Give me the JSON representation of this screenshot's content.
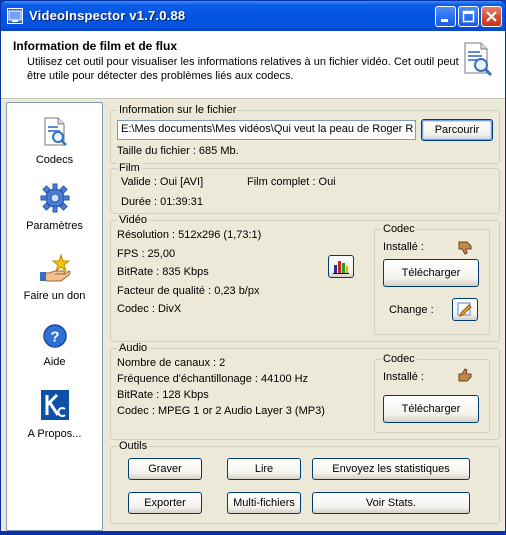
{
  "window": {
    "title": "VideoInspector v1.7.0.88"
  },
  "header": {
    "title": "Information de film et de flux",
    "description": "Utilisez cet outil pour visualiser les informations relatives à un fichier vidéo. Cet outil peut être utile pour détecter des problèmes liés aux codecs."
  },
  "sidebar": {
    "items": [
      {
        "label": "Codecs",
        "icon": "codecs-document-icon"
      },
      {
        "label": "Paramètres",
        "icon": "gear-icon"
      },
      {
        "label": "Faire un don",
        "icon": "donate-hand-icon"
      },
      {
        "label": "Aide",
        "icon": "help-icon"
      },
      {
        "label": "A Propos...",
        "icon": "about-logo-icon"
      }
    ]
  },
  "file": {
    "legend": "Information sur le fichier",
    "path": "E:\\Mes documents\\Mes vidéos\\Qui veut la peau de Roger R",
    "browse_label": "Parcourir",
    "size": "Taille du fichier : 685 Mb."
  },
  "film": {
    "legend": "Film",
    "valid": "Valide : Oui [AVI]",
    "complete": "Film complet : Oui",
    "duration": "Durée : 01:39:31"
  },
  "video": {
    "legend": "Vidéo",
    "resolution": "Résolution : 512x296 (1,73:1)",
    "fps": "FPS : 25,00",
    "bitrate": "BitRate : 835 Kbps",
    "quality": "Facteur de qualité : 0,23 b/px",
    "codec": "Codec : DivX",
    "codec_box": {
      "legend": "Codec",
      "installed_label": "Installé :",
      "installed_status": "not-installed",
      "download_label": "Télécharger",
      "change_label": "Change :"
    }
  },
  "audio": {
    "legend": "Audio",
    "channels": "Nombre de canaux : 2",
    "sample_rate": "Fréquence d'échantillonage : 44100 Hz",
    "bitrate": "BitRate : 128 Kbps",
    "codec": "Codec : MPEG 1 or 2 Audio Layer 3 (MP3)",
    "codec_box": {
      "legend": "Codec",
      "installed_label": "Installé :",
      "installed_status": "installed",
      "download_label": "Télécharger"
    }
  },
  "tools": {
    "legend": "Outils",
    "buttons": [
      "Graver",
      "Lire",
      "Envoyez les statistiques",
      "Exporter",
      "Multi-fichiers",
      "Voir Stats."
    ]
  },
  "colors": {
    "titlebar": "#0553e1",
    "window_bg": "#ece9d8",
    "accent_orange": "#f0a030"
  }
}
